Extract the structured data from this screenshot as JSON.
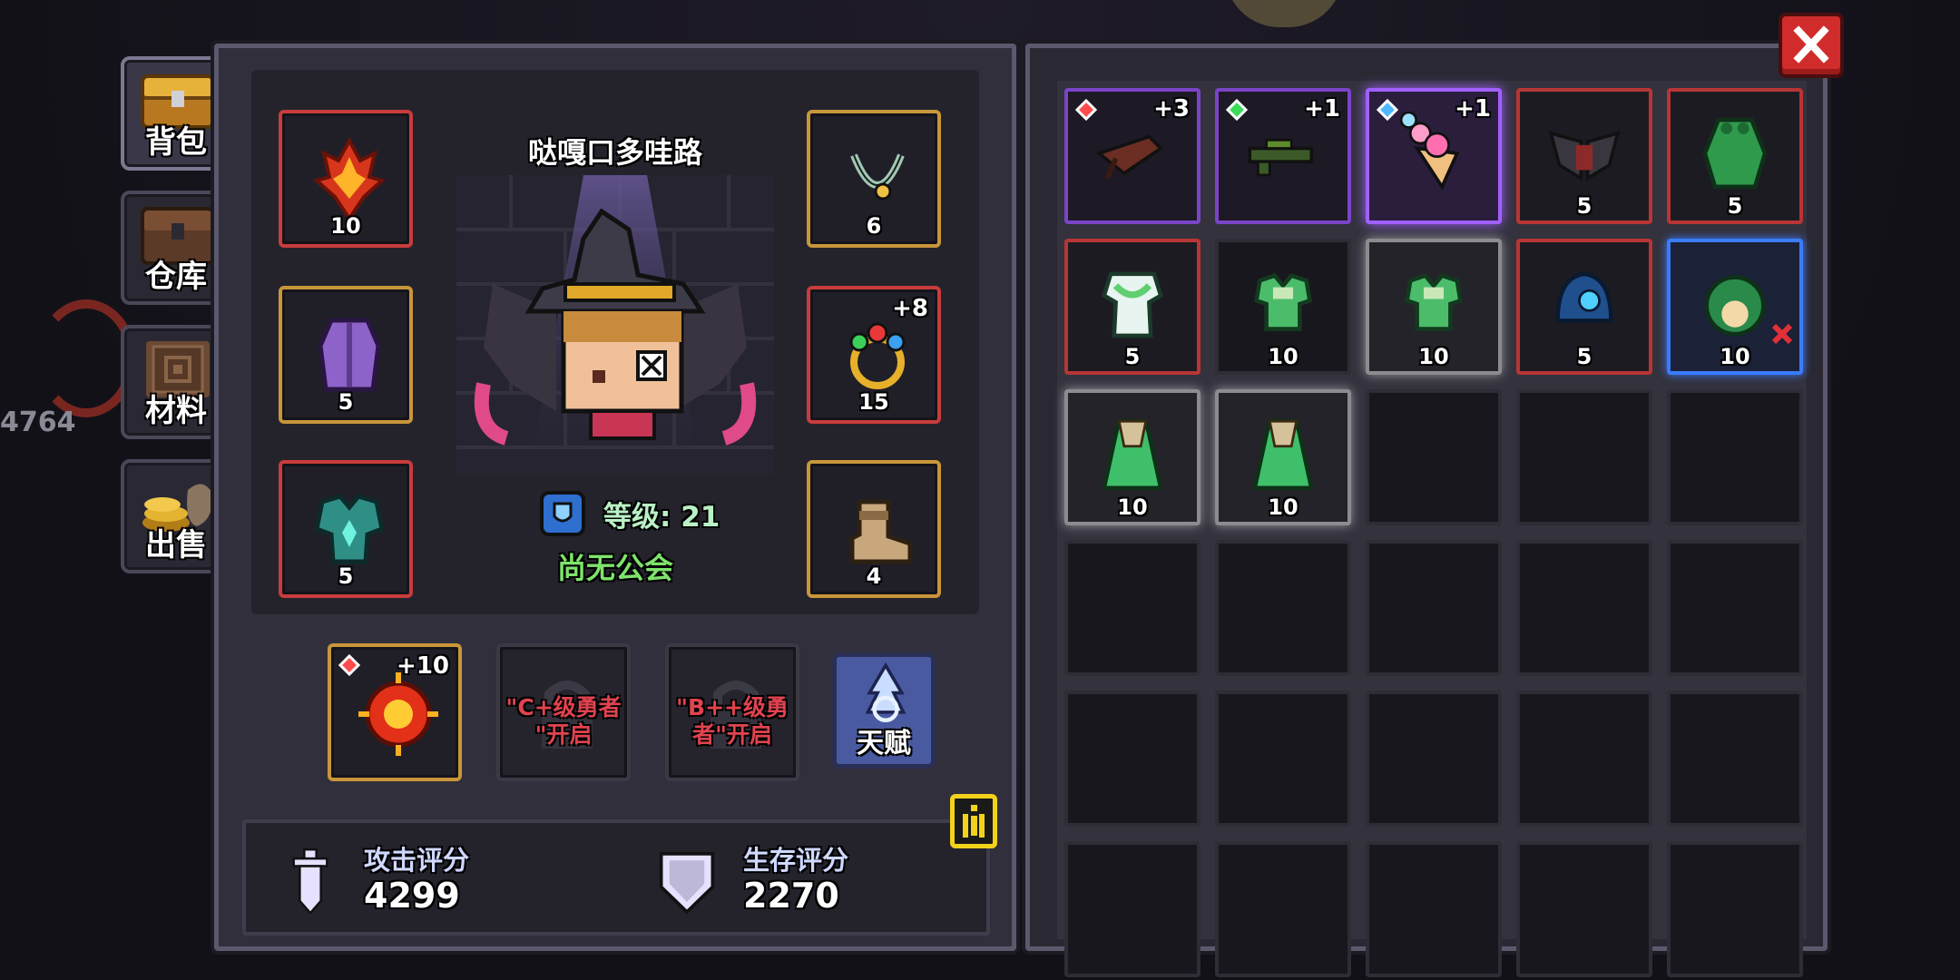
{
  "side_tabs": {
    "backpack": "背包",
    "storage": "仓库",
    "materials": "材料",
    "sell": "出售"
  },
  "bg_number": "4764",
  "character": {
    "name": "哒嘎口多哇路",
    "level_label": "等级: 21",
    "guild": "尚无公会"
  },
  "equipment": {
    "left": [
      {
        "count": "10",
        "icon": "fire-weapon-icon"
      },
      {
        "count": "5",
        "icon": "purple-robe-icon"
      },
      {
        "count": "5",
        "icon": "teal-armor-icon"
      }
    ],
    "right": [
      {
        "count": "6",
        "icon": "necklace-icon"
      },
      {
        "count": "15",
        "plus": "+8",
        "icon": "gem-ring-icon"
      },
      {
        "count": "4",
        "icon": "boots-icon"
      }
    ]
  },
  "bottom_slots": {
    "orb_plus": "+10",
    "lock1_text": "\"C+级勇者\"开启",
    "lock1_line1": "\"C+级勇者",
    "lock1_line2": "\"开启",
    "lock2_line1": "\"B++级勇",
    "lock2_line2": "者\"开启",
    "talent_label": "天赋"
  },
  "scores": {
    "attack_label": "攻击评分",
    "attack_value": "4299",
    "survival_label": "生存评分",
    "survival_value": "2270"
  },
  "inventory": [
    {
      "plus": "+3",
      "count": "",
      "style": "purple",
      "icon": "crossbow-icon",
      "gem": "red"
    },
    {
      "plus": "+1",
      "count": "",
      "style": "purple",
      "icon": "green-rifle-icon",
      "gem": "green"
    },
    {
      "plus": "+1",
      "count": "",
      "style": "purple-bright",
      "icon": "ice-cream-icon",
      "gem": "blue"
    },
    {
      "plus": "",
      "count": "5",
      "style": "red",
      "icon": "dark-wings-icon"
    },
    {
      "plus": "",
      "count": "5",
      "style": "red",
      "icon": "green-cloak-icon"
    },
    {
      "plus": "",
      "count": "5",
      "style": "red",
      "icon": "white-green-armor-icon"
    },
    {
      "plus": "",
      "count": "10",
      "style": "gray",
      "icon": "green-vest-icon"
    },
    {
      "plus": "",
      "count": "10",
      "style": "light",
      "icon": "green-vest-icon"
    },
    {
      "plus": "",
      "count": "5",
      "style": "red",
      "icon": "blue-helmet-icon"
    },
    {
      "plus": "",
      "count": "10",
      "style": "blue",
      "icon": "green-orb-icon"
    },
    {
      "plus": "",
      "count": "10",
      "style": "light",
      "icon": "green-robe-icon"
    },
    {
      "plus": "",
      "count": "10",
      "style": "light",
      "icon": "green-robe-icon"
    }
  ],
  "colors": {
    "accent_gold": "#c8963a",
    "rarity_red": "#c93c3c",
    "rarity_purple": "#7a44c8",
    "rarity_blue": "#3b7cff",
    "guild_green": "#7ee36b"
  }
}
